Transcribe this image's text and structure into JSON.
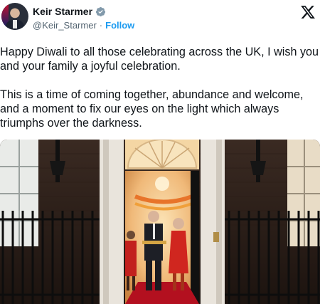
{
  "author": {
    "name": "Keir Starmer",
    "handle": "@Keir_Starmer",
    "separator": "·",
    "follow_label": "Follow",
    "verified_icon": "verified-badge-icon",
    "avatar_icon": "avatar"
  },
  "platform_icon": "x-logo-icon",
  "tweet": {
    "paragraph1": "Happy Diwali to all those celebrating across the UK, I wish you and your family a joyful celebration.",
    "paragraph2": "This is a time of coming together, abundance and welcome, and a moment to fix our eyes on the light which always triumphs over the darkness."
  },
  "colors": {
    "accent": "#1d9bf0",
    "text": "#0f1419",
    "muted": "#536471",
    "door_glow": "#f2c48d",
    "carpet": "#b3101f"
  }
}
